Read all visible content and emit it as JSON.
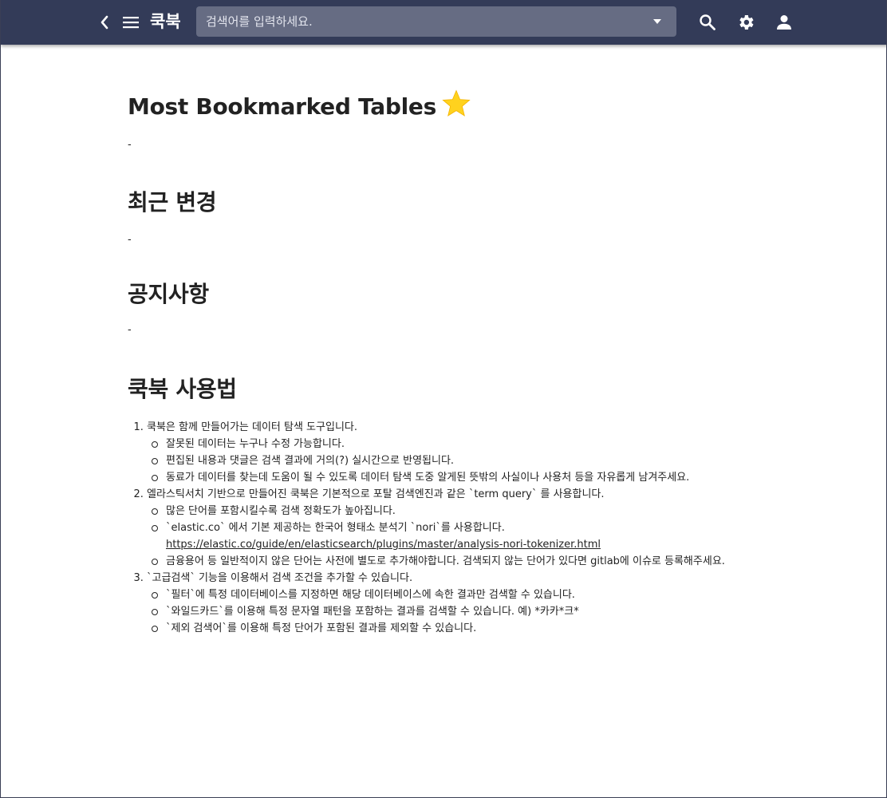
{
  "header": {
    "app_title": "쿡북",
    "search_placeholder": "검색어를 입력하세요.",
    "icons": {
      "back": "chevron-left-icon",
      "menu": "hamburger-menu-icon",
      "dropdown": "caret-down-icon",
      "search": "search-icon",
      "settings": "gear-icon",
      "account": "person-icon"
    },
    "colors": {
      "bar": "#333b58",
      "search_field": "#666c83"
    }
  },
  "sections": {
    "bookmarked": {
      "title": "Most Bookmarked Tables",
      "icon": "star-icon",
      "placeholder": "-"
    },
    "recent": {
      "title": "최근 변경",
      "placeholder": "-"
    },
    "notice": {
      "title": "공지사항",
      "placeholder": "-"
    },
    "usage": {
      "title": "쿡북 사용법",
      "items": [
        {
          "text": "쿡북은 함께 만들어가는 데이터 탐색 도구입니다.",
          "sub": [
            "잘못된 데이터는 누구나 수정 가능합니다.",
            "편집된 내용과 댓글은 검색 결과에 거의(?) 실시간으로 반영됩니다.",
            "동료가 데이터를 찾는데 도움이 될 수 있도록 데이터 탐색 도중 알게된 뜻밖의 사실이나 사용처 등을 자유롭게 남겨주세요."
          ]
        },
        {
          "text": "엘라스틱서치 기반으로 만들어진 쿡북은 기본적으로 포탈 검색엔진과 같은 `term query` 를 사용합니다.",
          "sub": [
            "많은 단어를 포함시킬수록 검색 정확도가 높아집니다.",
            "`elastic.co` 에서 기본 제공하는 한국어 형태소 분석기 `nori`를 사용합니다.",
            "금융용어 등 일반적이지 않은 단어는 사전에 별도로 추가해야합니다. 검색되지 않는 단어가 있다면 gitlab에 이슈로 등록해주세요."
          ],
          "link": "https://elastic.co/guide/en/elasticsearch/plugins/master/analysis-nori-tokenizer.html"
        },
        {
          "text": "`고급검색` 기능을 이용해서 검색 조건을 추가할 수 있습니다.",
          "sub": [
            "`필터`에 특정 데이터베이스를 지정하면 해당 데이터베이스에 속한 결과만 검색할 수 있습니다.",
            "`와일드카드`를 이용해 특정 문자열 패턴을 포함하는 결과를 검색할 수 있습니다. 예) *카카*크*",
            "`제외 검색어`를 이용해 특정 단어가 포함된 결과를 제외할 수 있습니다."
          ]
        }
      ]
    }
  }
}
